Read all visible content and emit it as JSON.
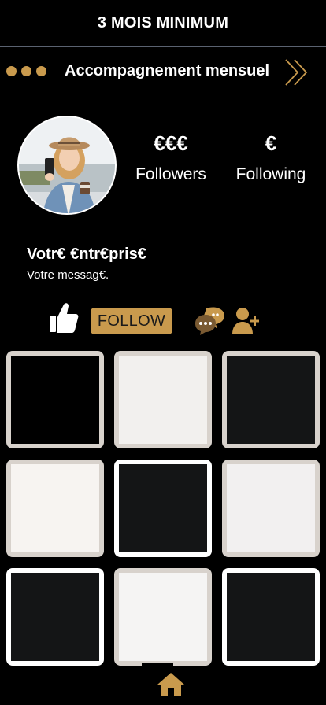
{
  "header": {
    "title": "3 MOIS MINIMUM"
  },
  "banner": {
    "title": "Accompagnement mensuel",
    "dots_color": "#c99a4d",
    "icon": "double-chevron-right-icon"
  },
  "profile": {
    "avatar_icon": "profile-photo",
    "stats": [
      {
        "value": "€€€",
        "label": "Followers"
      },
      {
        "value": "€",
        "label": "Following"
      }
    ],
    "business_name": "Votr€ €ntr€pris€",
    "message": "Votre messag€."
  },
  "actions": {
    "like_icon": "thumbs-up-icon",
    "follow_label": "FOLLOW",
    "chat_icon": "chat-bubbles-icon",
    "add_user_icon": "add-user-icon",
    "accent": "#c99a4d"
  },
  "grid": {
    "tiles": [
      {
        "inner": "#000000",
        "frame": "photo"
      },
      {
        "inner": "#f2f0ee",
        "frame": "photo"
      },
      {
        "inner": "#141516",
        "frame": "photo"
      },
      {
        "inner": "#f7f4f1",
        "frame": "photo"
      },
      {
        "inner": "#141516",
        "frame": "white"
      },
      {
        "inner": "#f2f0f0",
        "frame": "photo"
      },
      {
        "inner": "#141516",
        "frame": "white"
      },
      {
        "inner": "#f5f4f3",
        "frame": "photo"
      },
      {
        "inner": "#141516",
        "frame": "white"
      }
    ]
  },
  "nav": {
    "home_icon": "home-icon"
  }
}
